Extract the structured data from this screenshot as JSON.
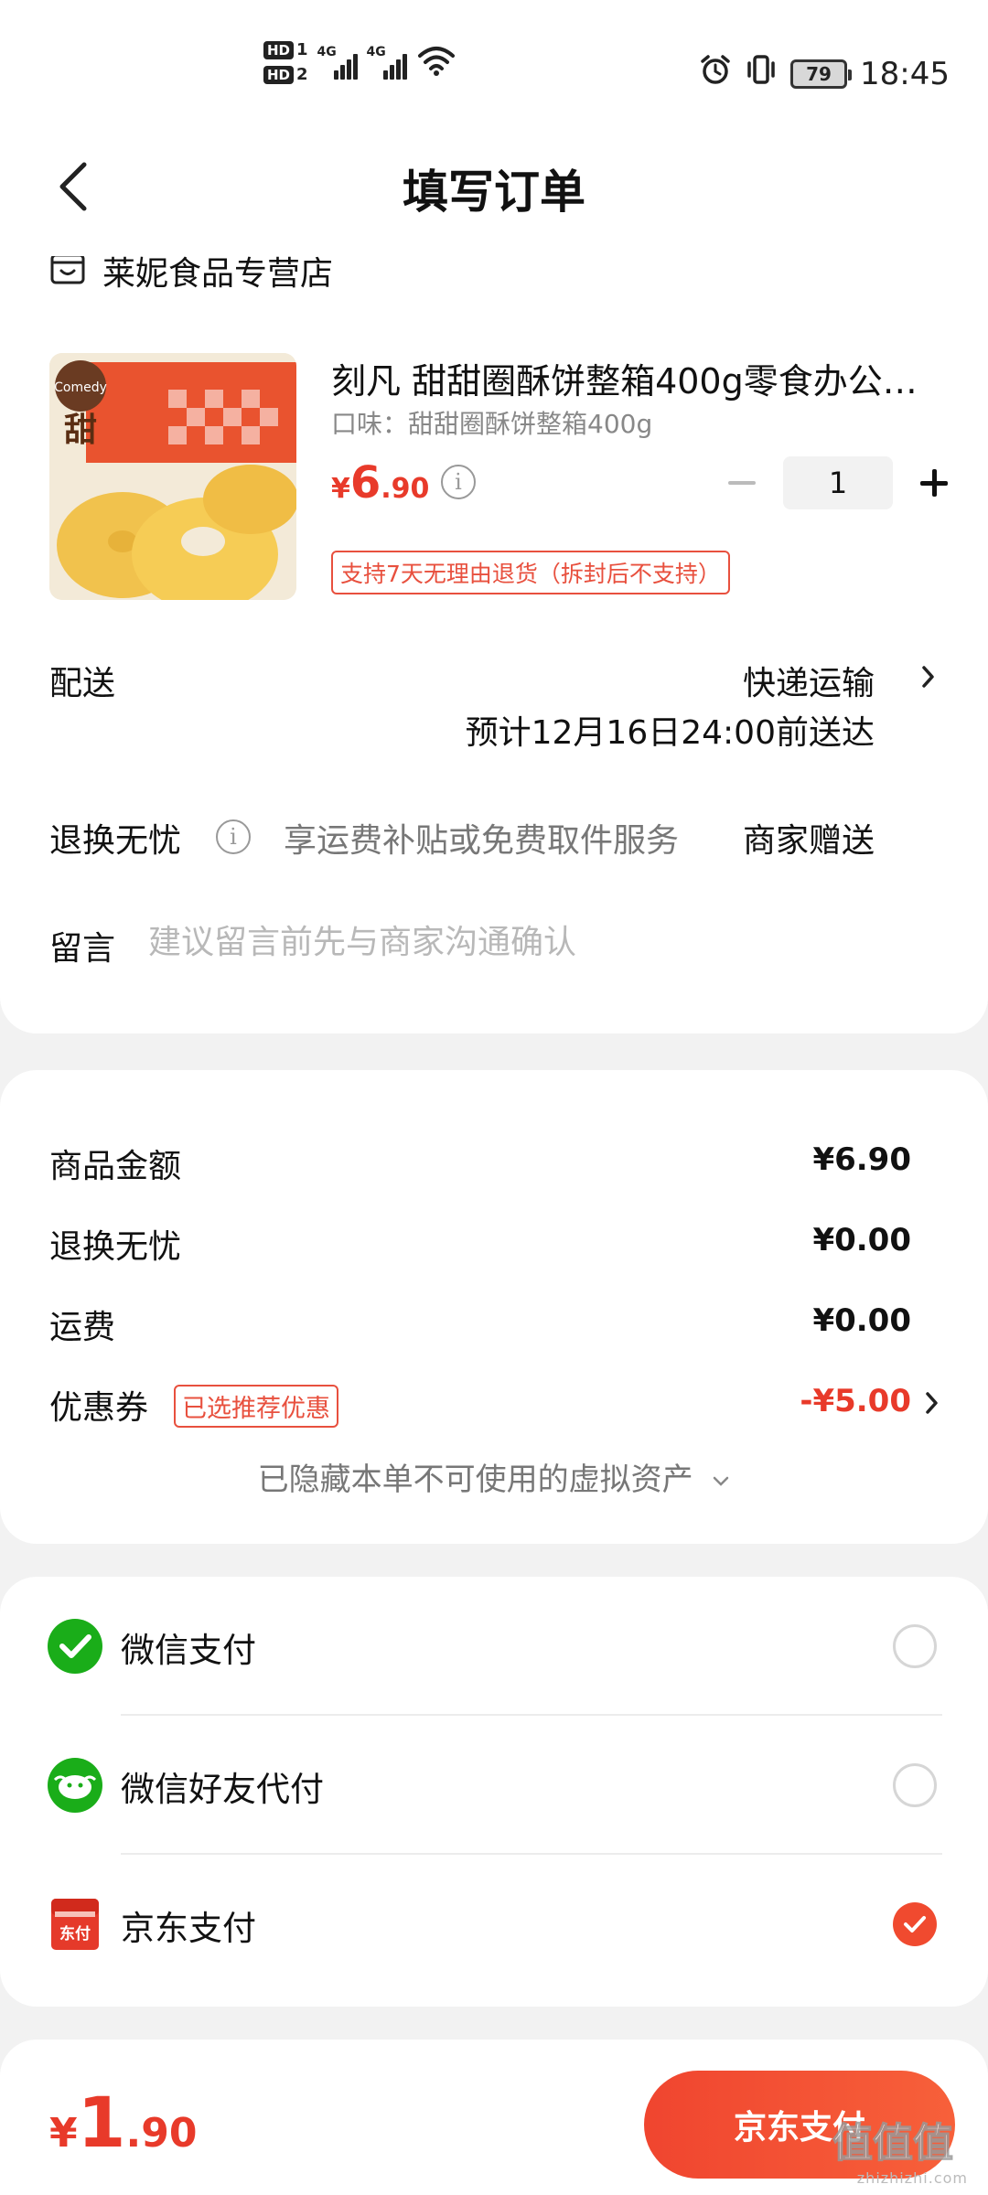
{
  "status_bar": {
    "sim1": "HD",
    "sim1_num": "1",
    "sim2": "HD",
    "sim2_num": "2",
    "net1": "4G",
    "net2": "4G",
    "battery": "79",
    "time": "18:45"
  },
  "header": {
    "title": "填写订单"
  },
  "store": {
    "name": "莱妮食品专营店"
  },
  "product": {
    "title": "刻凡 甜甜圈酥饼整箱400g零食办公…",
    "spec": "口味：甜甜圈酥饼整箱400g",
    "price_currency": "¥",
    "price_int": "6",
    "price_dec": ".90",
    "quantity": "1",
    "return_policy": "支持7天无理由退货（拆封后不支持）"
  },
  "delivery": {
    "label": "配送",
    "method": "快递运输",
    "eta": "预计12月16日24:00前送达"
  },
  "insurance": {
    "label": "退换无忧",
    "desc": "享运费补贴或免费取件服务",
    "gift": "商家赠送"
  },
  "remark": {
    "label": "留言",
    "placeholder": "建议留言前先与商家沟通确认"
  },
  "fees": {
    "goods_label": "商品金额",
    "goods_value": "¥6.90",
    "insurance_label": "退换无忧",
    "insurance_value": "¥0.00",
    "shipping_label": "运费",
    "shipping_value": "¥0.00",
    "coupon_label": "优惠券",
    "coupon_tag": "已选推荐优惠",
    "coupon_value": "-¥5.00",
    "hidden_assets": "已隐藏本单不可使用的虚拟资产"
  },
  "payment": {
    "options": [
      {
        "label": "微信支付",
        "checked": false,
        "icon": "wechat-pay-icon"
      },
      {
        "label": "微信好友代付",
        "checked": false,
        "icon": "wechat-friend-pay-icon"
      },
      {
        "label": "京东支付",
        "checked": true,
        "icon": "jd-pay-icon"
      }
    ],
    "jd_icon_text": "东付"
  },
  "bottom": {
    "total_currency": "¥",
    "total_int": "1",
    "total_dec": ".90",
    "pay_button": "京东支付",
    "watermark": "值值值",
    "watermark_url": "zhizhizhi.com"
  },
  "colors": {
    "accent": "#e83a2a",
    "wechat_green": "#1aad19"
  }
}
